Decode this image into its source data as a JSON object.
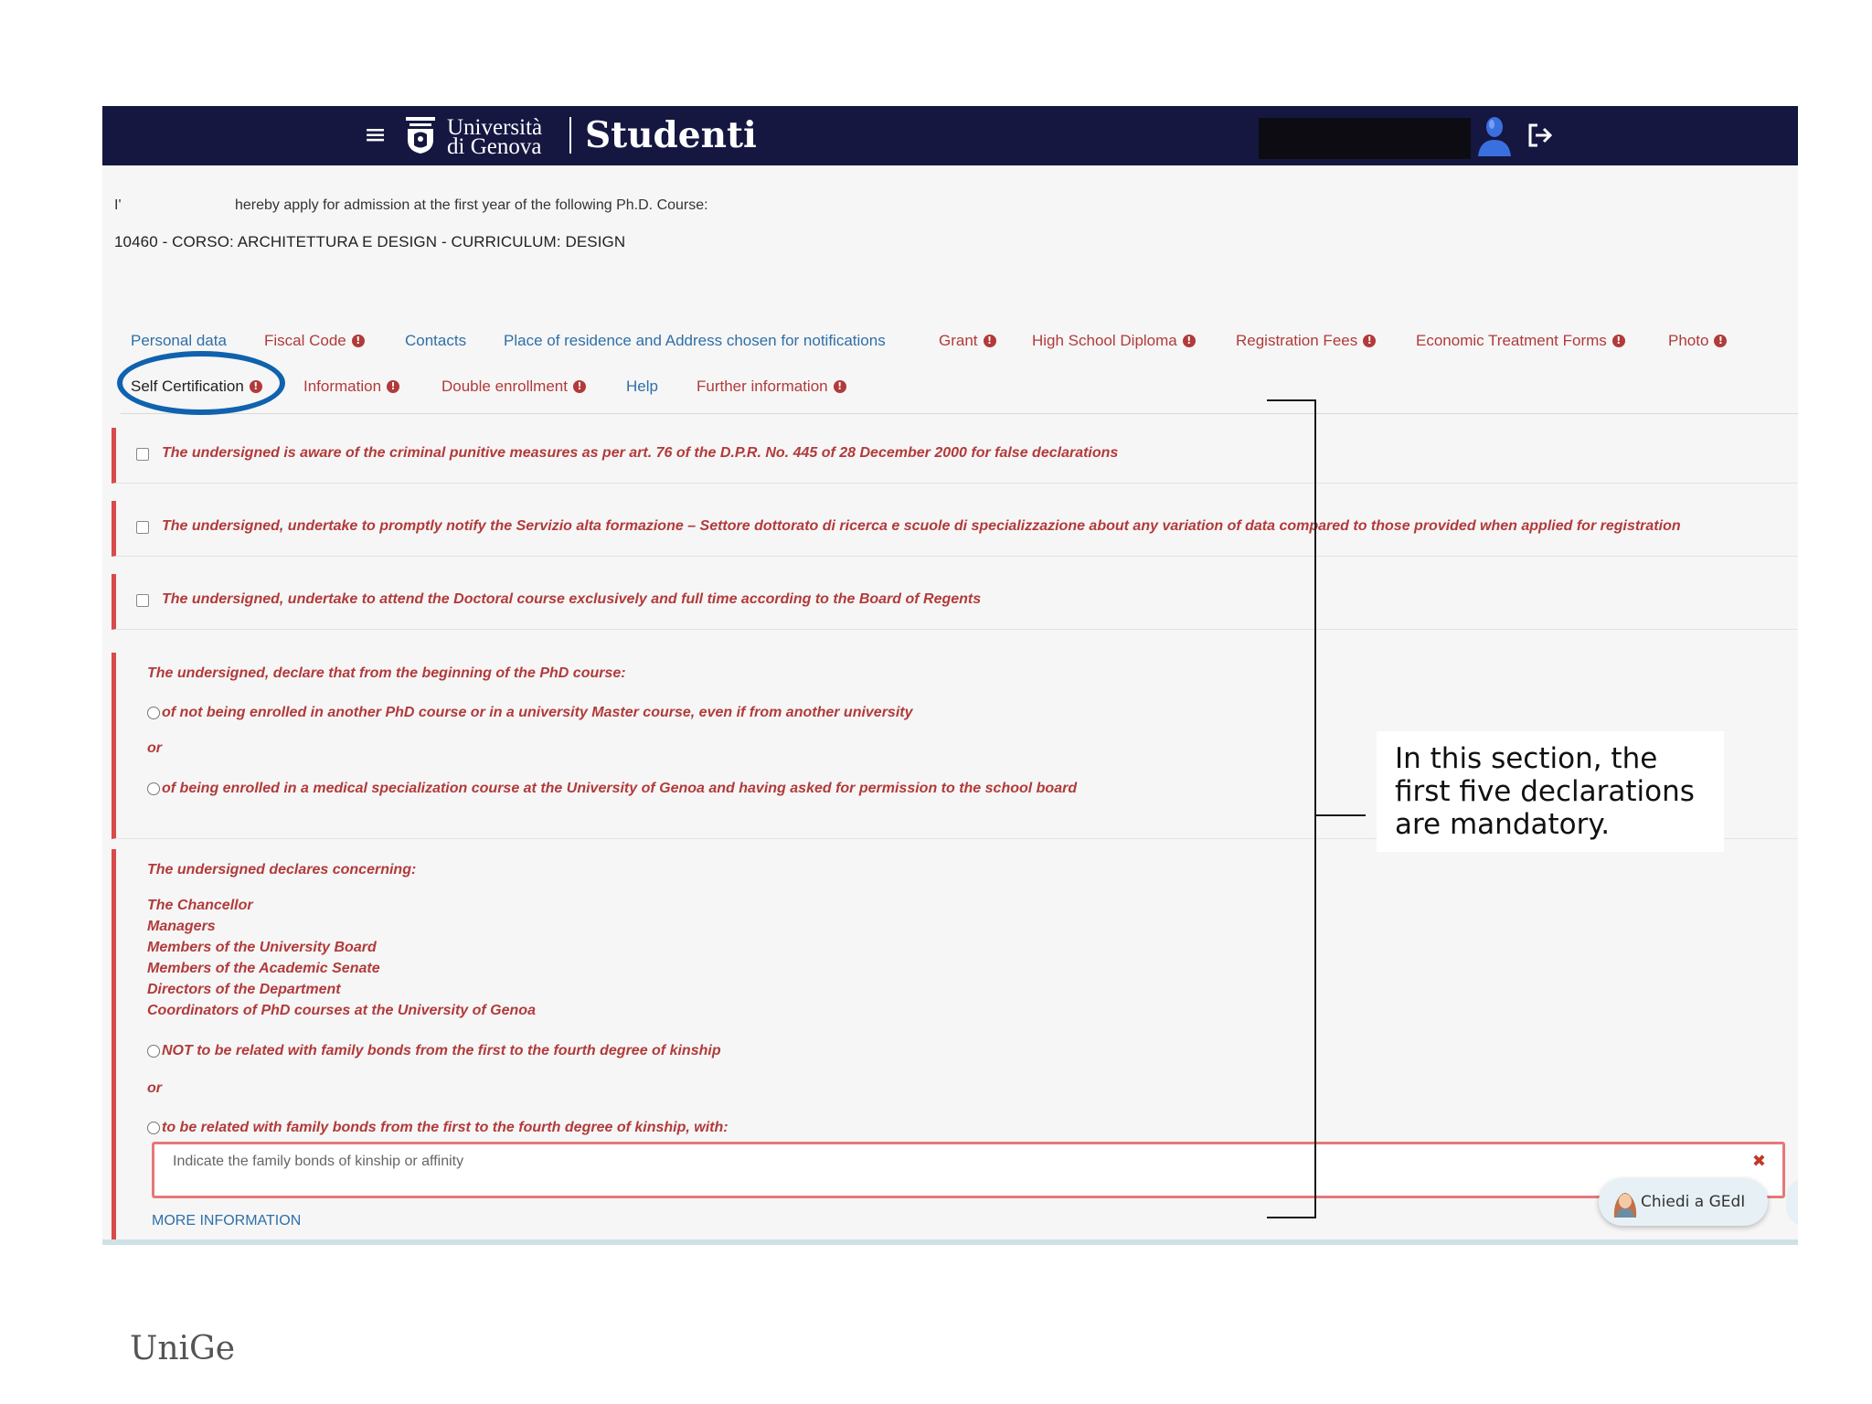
{
  "header": {
    "university_line1": "Università",
    "university_line2": "di Genova",
    "app_title": "Studenti"
  },
  "intro": {
    "applicant_initial": "I'",
    "apply_text": "hereby apply for admission at the first year of the following Ph.D. Course:",
    "course": "10460 - CORSO: ARCHITETTURA E DESIGN - CURRICULUM: DESIGN"
  },
  "tabs_row1": [
    {
      "label": "Personal data",
      "warning": false
    },
    {
      "label": "Fiscal Code",
      "warning": true
    },
    {
      "label": "Contacts",
      "warning": false
    },
    {
      "label": "Place of residence and Address chosen for notifications",
      "warning": false
    },
    {
      "label": "Grant",
      "warning": true
    },
    {
      "label": "High School Diploma",
      "warning": true
    },
    {
      "label": "Registration Fees",
      "warning": true
    },
    {
      "label": "Economic Treatment Forms",
      "warning": true
    },
    {
      "label": "Photo",
      "warning": true
    }
  ],
  "tabs_row2": [
    {
      "label": "Self Certification",
      "warning": true,
      "active": true
    },
    {
      "label": "Information",
      "warning": true
    },
    {
      "label": "Double enrollment",
      "warning": true
    },
    {
      "label": "Help",
      "warning": false
    },
    {
      "label": "Further information",
      "warning": true
    }
  ],
  "declarations": {
    "d1": "The undersigned is aware of the criminal punitive measures as per art. 76 of the D.P.R. No. 445 of 28 December 2000 for false declarations",
    "d2": "The undersigned, undertake to promptly notify the Servizio alta formazione – Settore dottorato di ricerca e scuole di specializzazione about any variation of data compared to those provided when applied for registration",
    "d3": "The undersigned, undertake to attend the Doctoral course exclusively and full time according to the Board of Regents",
    "d4_title": "The undersigned, declare that from the beginning of the PhD course:",
    "d4_opt1": "of not being enrolled in another PhD course or in a university Master course, even if from another university",
    "d4_or": "or",
    "d4_opt2": "of being enrolled in a medical specialization course at the University of Genoa and having asked for permission to the school board",
    "d5_title": "The undersigned declares concerning:",
    "d5_roles": [
      "The Chancellor",
      "Managers",
      "Members of the University Board",
      "Members of the Academic Senate",
      "Directors of the Department",
      "Coordinators of PhD courses at the University of Genoa"
    ],
    "d5_opt1": "NOT to be related with family bonds from the first to the fourth degree of kinship",
    "d5_or": "or",
    "d5_opt2": "to be related with family bonds from the first to the fourth degree of kinship, with:",
    "kinship_placeholder": "Indicate the family bonds of kinship or affinity",
    "more_info": "MORE INFORMATION"
  },
  "chat": {
    "label": "Chiedi a GEdI"
  },
  "annotation": {
    "note": "In this section, the first five declarations are mandatory."
  },
  "footer": {
    "logo_text": "UniGe"
  },
  "colors": {
    "header_bg": "#151741",
    "accent_red": "#b23a3a",
    "link_blue": "#2f6fa8",
    "highlight_blue": "#1062ae"
  }
}
